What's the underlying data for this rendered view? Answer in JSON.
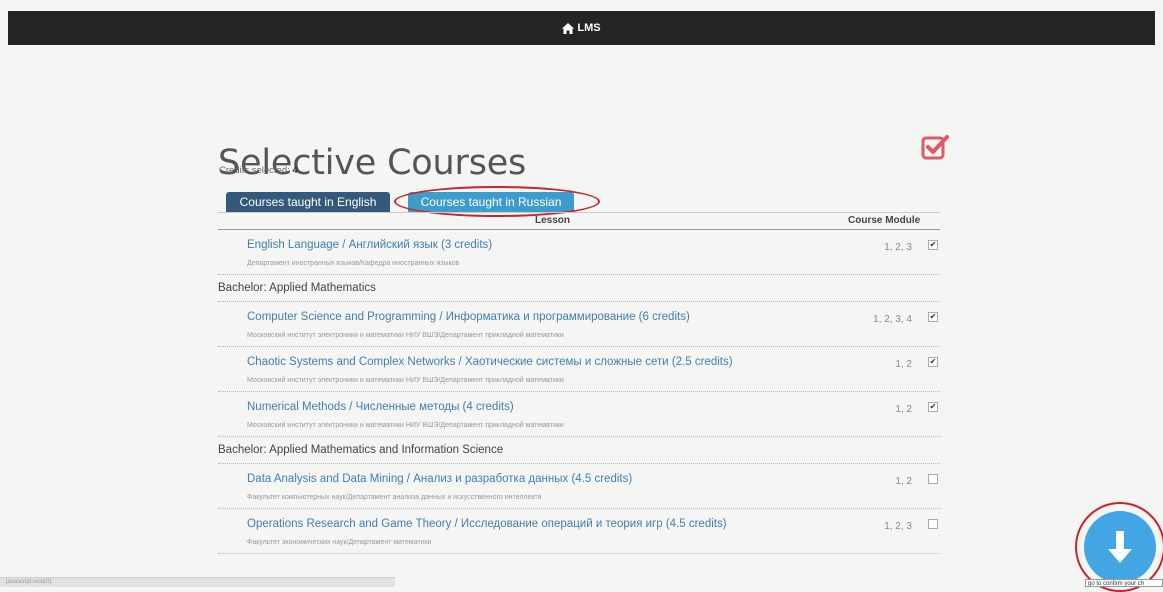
{
  "app": {
    "title": "LMS",
    "home_icon": "home-icon"
  },
  "page": {
    "title": "Selective Courses",
    "logo_icon": "check-square-icon",
    "accent": "#e05a66"
  },
  "credits": {
    "label": "Credits selected:",
    "value": "4"
  },
  "tabs": [
    {
      "label": "Courses taught in English",
      "color": "#35597a"
    },
    {
      "label": "Courses taught in Russian",
      "color": "#3e9ccc"
    }
  ],
  "table": {
    "headers": {
      "lesson": "Lesson",
      "course_module": "Course Module"
    },
    "rows": [
      {
        "type": "course",
        "name": "English Language / Английский язык (3 credits)",
        "dept": "Департамент иностранных языков/Кафедра иностранных языков",
        "modules": "1, 2, 3",
        "checked": true
      },
      {
        "type": "group",
        "label": "Bachelor: Applied Mathematics"
      },
      {
        "type": "course",
        "name": "Computer Science and Programming / Информатика и программирование (6 credits)",
        "dept": "Московский институт электроники и математики НИУ ВШЭ/Департамент прикладной математики",
        "modules": "1, 2, 3, 4",
        "checked": true
      },
      {
        "type": "course",
        "name": "Chaotic Systems and Complex Networks / Хаотические системы и сложные сети (2.5 credits)",
        "dept": "Московский институт электроники и математики НИУ ВШЭ/Департамент прикладной математики",
        "modules": "1, 2",
        "checked": true
      },
      {
        "type": "course",
        "name": "Numerical Methods / Численные методы (4 credits)",
        "dept": "Московский институт электроники и математики НИУ ВШЭ/Департамент прикладной математики",
        "modules": "1, 2",
        "checked": true
      },
      {
        "type": "group",
        "label": "Bachelor: Applied Mathematics and Information Science"
      },
      {
        "type": "course",
        "name": "Data Analysis and Data Mining / Анализ и разработка данных (4.5 credits)",
        "dept": "Факультет компьютерных наук/Департамент анализа данных и искусственного интеллекта",
        "modules": "1, 2",
        "checked": false
      },
      {
        "type": "course",
        "name": "Operations Research and Game Theory / Исследование операций и теория игр (4.5 credits)",
        "dept": "Факультет экономических наук/Департамент математики",
        "modules": "1, 2, 3",
        "checked": false
      }
    ]
  },
  "fab": {
    "icon": "arrow-down-icon",
    "tooltip": "go to confirm your ch"
  },
  "statusbar": {
    "text": "javascript:void(0)"
  }
}
